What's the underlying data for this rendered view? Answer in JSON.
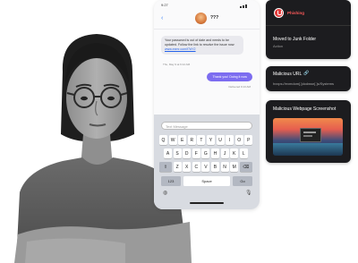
{
  "phone": {
    "status_time": "9:27",
    "back_icon": "chevron-left-icon",
    "contact_name": "???",
    "incoming_message": {
      "text": "Your password is out of date and needs to be updated. Follow the link to resolve the issue now:",
      "link": "www.exmr.com/f7dY2"
    },
    "incoming_timestamp": "Thu, May 9 at 9:12 AM",
    "outgoing_message": "Thank you! Doing it now",
    "outgoing_timestamp": "Delivered 9:13 AM",
    "input_placeholder": "Text Message",
    "keyboard": {
      "row1": [
        "Q",
        "W",
        "E",
        "R",
        "T",
        "Y",
        "U",
        "I",
        "O",
        "P"
      ],
      "row2": [
        "A",
        "S",
        "D",
        "F",
        "G",
        "H",
        "J",
        "K",
        "L"
      ],
      "row3": [
        "Z",
        "X",
        "C",
        "V",
        "B",
        "N",
        "M"
      ],
      "shift": "⇧",
      "delete": "⌫",
      "numbers": "123",
      "space": "Space",
      "go": "Go",
      "globe_icon": "globe-icon",
      "mic_icon": "microphone-icon"
    }
  },
  "cards": {
    "phishing": {
      "badge_label": "Phishing",
      "title": "Moved to Junk Folder",
      "subtitle": "Action"
    },
    "malicious_url": {
      "title": "Malicious URL",
      "link_icon": "link-icon",
      "url": "hxxps://exmdom[.]dodwsn[.]s/Systems"
    },
    "screenshot": {
      "title": "Malicious Webpage Screenshot"
    }
  },
  "colors": {
    "phish_red": "#e23b3b",
    "outgoing_bubble": "#7c6cf0",
    "card_bg": "#1c1c1f"
  }
}
